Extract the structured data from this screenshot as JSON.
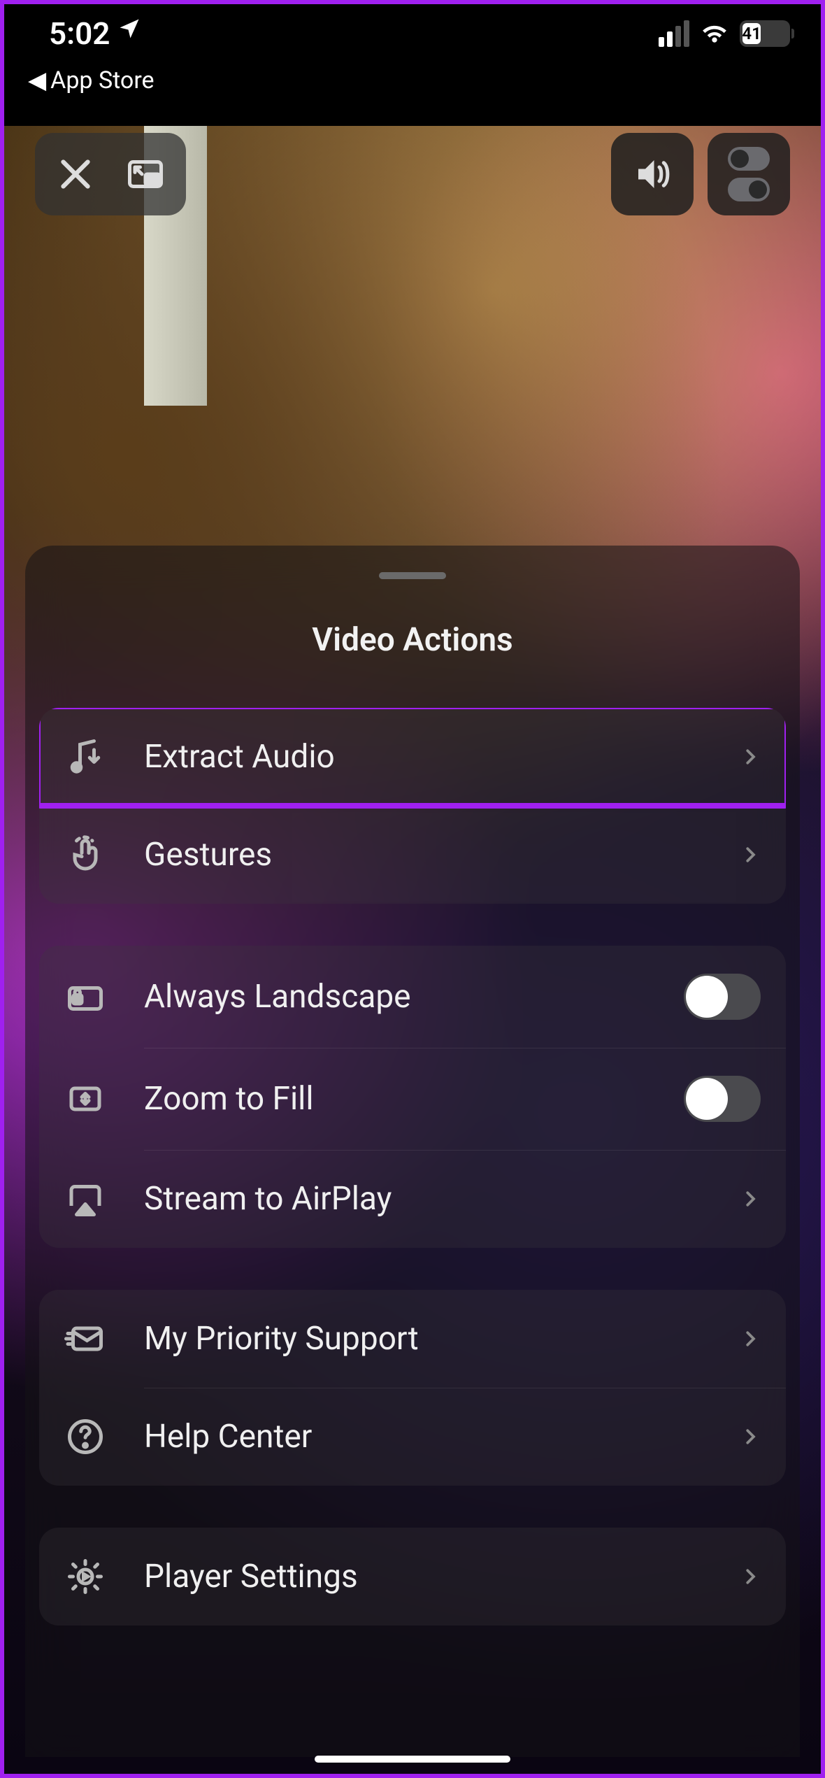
{
  "status": {
    "time": "5:02",
    "back_app": "App Store",
    "battery_pct": "41",
    "battery_fill_pct": 41
  },
  "sheet": {
    "title": "Video Actions",
    "groups": [
      {
        "rows": [
          {
            "id": "extract-audio",
            "label": "Extract Audio",
            "type": "link",
            "highlight": true
          },
          {
            "id": "gestures",
            "label": "Gestures",
            "type": "link"
          }
        ]
      },
      {
        "rows": [
          {
            "id": "always-landscape",
            "label": "Always Landscape",
            "type": "toggle",
            "on": false
          },
          {
            "id": "zoom-to-fill",
            "label": "Zoom to Fill",
            "type": "toggle",
            "on": false
          },
          {
            "id": "stream-airplay",
            "label": "Stream to AirPlay",
            "type": "link"
          }
        ]
      },
      {
        "rows": [
          {
            "id": "priority-support",
            "label": "My Priority Support",
            "type": "link"
          },
          {
            "id": "help-center",
            "label": "Help Center",
            "type": "link"
          }
        ]
      },
      {
        "rows": [
          {
            "id": "player-settings",
            "label": "Player Settings",
            "type": "link"
          }
        ]
      }
    ]
  },
  "colors": {
    "accent": "#a020f0"
  }
}
